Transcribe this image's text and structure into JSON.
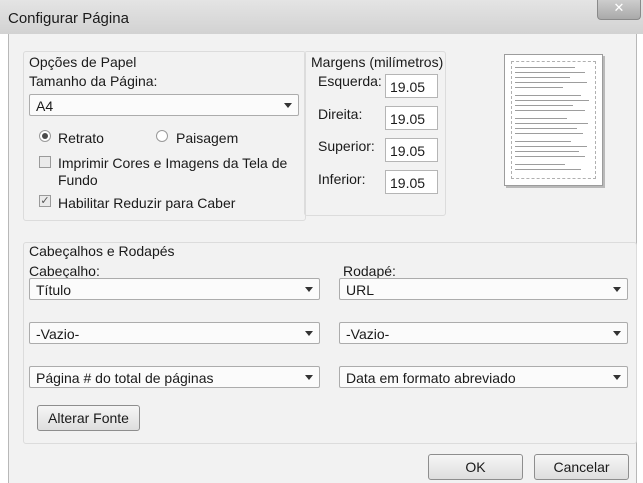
{
  "window": {
    "title": "Configurar Página",
    "close_glyph": "✕"
  },
  "paper": {
    "group_label": "Opções de Papel",
    "size_label": "Tamanho da Página:",
    "size_value": "A4",
    "portrait_label": "Retrato",
    "landscape_label": "Paisagem",
    "orientation_selected": "Retrato",
    "print_bg_label_line1": "Imprimir Cores e Imagens da Tela de",
    "print_bg_label_line2": "Fundo",
    "print_bg_checked": false,
    "shrink_label": "Habilitar Reduzir para Caber",
    "shrink_checked": true
  },
  "margins": {
    "group_label": "Margens (milímetros)",
    "left_label": "Esquerda:",
    "left_value": "19.05",
    "right_label": "Direita:",
    "right_value": "19.05",
    "top_label": "Superior:",
    "top_value": "19.05",
    "bottom_label": "Inferior:",
    "bottom_value": "19.05"
  },
  "headers_footers": {
    "group_label": "Cabeçalhos e Rodapés",
    "header_label": "Cabeçalho:",
    "footer_label": "Rodapé:",
    "header_values": [
      "Título",
      "-Vazio-",
      "Página # do total de páginas"
    ],
    "footer_values": [
      "URL",
      "-Vazio-",
      "Data em formato abreviado"
    ],
    "change_font_label": "Alterar Fonte"
  },
  "buttons": {
    "ok_label": "OK",
    "cancel_label": "Cancelar"
  }
}
